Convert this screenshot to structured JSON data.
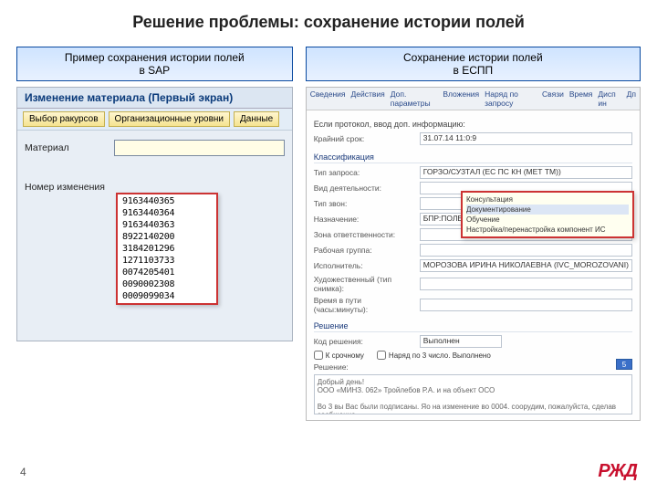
{
  "title": "Решение проблемы: сохранение истории полей",
  "pageNumber": "4",
  "logo": "РЖД",
  "left": {
    "header": "Пример сохранения истории полей\nв SAP",
    "windowTitle": "Изменение материала (Первый экран)",
    "buttons": {
      "b1": "Выбор ракурсов",
      "b2": "Организационные уровни",
      "b3": "Данные"
    },
    "labels": {
      "material": "Материал",
      "changeNo": "Номер изменения"
    },
    "inputValue": "",
    "dropdown": [
      "9163440365",
      "9163440364",
      "9163440363",
      "8922140200",
      "3184201296",
      "1271103733",
      "0074205401",
      "0090002308",
      "0009099034"
    ]
  },
  "right": {
    "header": "Сохранение истории полей\nв ЕСПП",
    "tabs": [
      "Сведения",
      "Действия",
      "Доп. параметры",
      "Вложения",
      "Наряд по запросу",
      "Связи",
      "Время",
      "Дисп ин",
      "Дп"
    ],
    "heading1": "Если протокол, ввод доп. информацию:",
    "rows": {
      "deadline_lbl": "Крайний срок:",
      "deadline_val": "31.07.14 11:0:9",
      "section_cls": "Классификация",
      "tipzap_lbl": "Тип запроса:",
      "tipzap_val": "ГОРЗО/СУЗТАЛ (ЕС ПС КН (МЕТ ТМ))",
      "vid_lbl": "Вид деятельности:",
      "tip_lbl": "Тип звон:",
      "nazn_lbl": "Назначение:",
      "nazn_val": "БПР:ПОЛЕКТИКА-1 ГОР",
      "zona_lbl": "Зона ответственности:",
      "rg_lbl": "Рабочая группа:",
      "isp_lbl": "Исполнитель:",
      "isp_val": "МОРОЗОВА ИРИНА НИКОЛАЕВНА (IVC_MOROZOVANI)",
      "hud_lbl": "Художественный (тип снимка):",
      "vremya_lbl": "Время в пути (часы:минуты):",
      "section_res": "Решение",
      "kod_lbl": "Код решения:",
      "kod_val": "Выполнен",
      "chk1": "К срочному",
      "chk2": "Наряд по 3 число. Выполнено",
      "res_lbl": "Решение:",
      "textarea": "Добрый день!\nООО «МИНЗ. 062» Тройлебов Р.А. и на объект ОСО\n\nВо 3 вы Вас были подписаны. Яо на изменение во 0004. соорудим, пожалуйста, сделав\nсообщение.\nС уважением,"
    },
    "popup": [
      "Консультация",
      "Документирование",
      "Обучение",
      "Настройка/перенастройка компонент ИС"
    ],
    "pagerHint": "5"
  }
}
